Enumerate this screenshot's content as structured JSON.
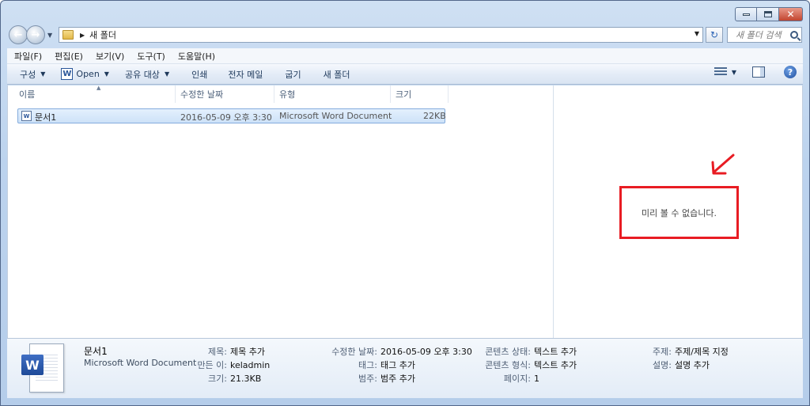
{
  "window": {
    "caption": {
      "close_glyph": "✕"
    }
  },
  "address_bar": {
    "path": [
      "새 폴더"
    ],
    "search_placeholder": "새 폴더 검색"
  },
  "menu": [
    "파일(F)",
    "편집(E)",
    "보기(V)",
    "도구(T)",
    "도움말(H)"
  ],
  "command_bar": {
    "organize": "구성",
    "open": "Open",
    "share": "공유 대상",
    "print": "인쇄",
    "email": "전자 메일",
    "burn": "굽기",
    "new_folder": "새 폴더",
    "help_glyph": "?"
  },
  "columns": [
    "이름",
    "수정한 날짜",
    "유형",
    "크기"
  ],
  "files": [
    {
      "name": "문서1",
      "modified": "2016-05-09 오후 3:30",
      "type": "Microsoft Word Document",
      "size": "22KB"
    }
  ],
  "preview": {
    "message": "미리 볼 수 없습니다."
  },
  "details": {
    "name": "문서1",
    "type": "Microsoft Word Document",
    "props": {
      "title_k": "제목:",
      "title_v": "제목 추가",
      "author_k": "만든 이:",
      "author_v": "keladmin",
      "size_k": "크기:",
      "size_v": "21.3KB",
      "modified_k": "수정한 날짜:",
      "modified_v": "2016-05-09 오후 3:30",
      "tags_k": "태그:",
      "tags_v": "태그 추가",
      "category_k": "범주:",
      "category_v": "범주 추가",
      "content_status_k": "콘텐츠 상태:",
      "content_status_v": "텍스트 추가",
      "content_type_k": "콘텐츠 형식:",
      "content_type_v": "텍스트 추가",
      "pages_k": "페이지:",
      "pages_v": "1",
      "subject_k": "주제:",
      "subject_v": "주제/제목 지정",
      "comments_k": "설명:",
      "comments_v": "설명 추가"
    }
  },
  "colors": {
    "annotation_red": "#e81c23",
    "selection": "#cde2f8"
  }
}
